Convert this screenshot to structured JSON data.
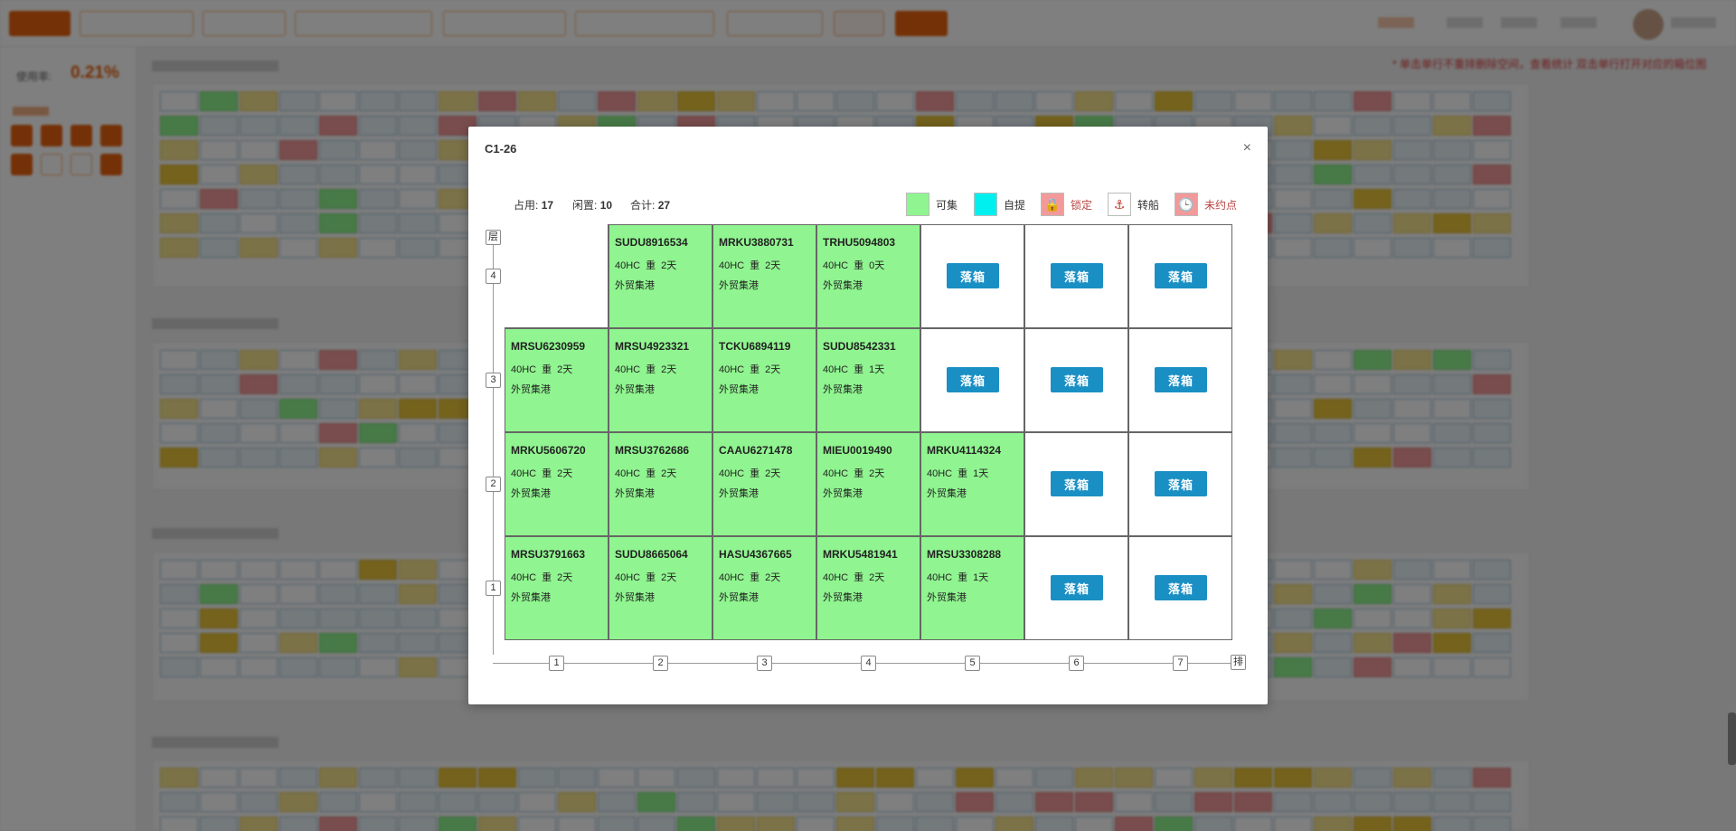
{
  "modal": {
    "title": "C1-26",
    "close": "×",
    "stats": {
      "occupied_label": "占用:",
      "occupied": "17",
      "idle_label": "闲置:",
      "idle": "10",
      "total_label": "合计:",
      "total": "27"
    },
    "legend": [
      {
        "label": "可集",
        "color": "#90f590",
        "icon": ""
      },
      {
        "label": "自提",
        "color": "#00f0f0",
        "icon": ""
      },
      {
        "label": "锁定",
        "color": "#f29a9a",
        "icon": "lock-icon",
        "glyph": "🔒"
      },
      {
        "label": "转船",
        "color": "#ffffff",
        "icon": "anchor-icon",
        "glyph": "⚓"
      },
      {
        "label": "未约点",
        "color": "#f29a9a",
        "icon": "clock-icon",
        "glyph": "🕒"
      }
    ],
    "axis": {
      "tier_label": "层",
      "row_label": "排",
      "tiers": [
        "4",
        "3",
        "2",
        "1"
      ],
      "rows": [
        "1",
        "2",
        "3",
        "4",
        "5",
        "6",
        "7"
      ]
    },
    "drop_label": "落箱",
    "grid": [
      [
        null,
        {
          "code": "SUDU8916534",
          "type": "40HC",
          "weight": "重",
          "days": "2天",
          "yard": "外贸集港"
        },
        {
          "code": "MRKU3880731",
          "type": "40HC",
          "weight": "重",
          "days": "2天",
          "yard": "外贸集港"
        },
        {
          "code": "TRHU5094803",
          "type": "40HC",
          "weight": "重",
          "days": "0天",
          "yard": "外贸集港"
        },
        "drop",
        "drop",
        "drop"
      ],
      [
        {
          "code": "MRSU6230959",
          "type": "40HC",
          "weight": "重",
          "days": "2天",
          "yard": "外贸集港"
        },
        {
          "code": "MRSU4923321",
          "type": "40HC",
          "weight": "重",
          "days": "2天",
          "yard": "外贸集港"
        },
        {
          "code": "TCKU6894119",
          "type": "40HC",
          "weight": "重",
          "days": "2天",
          "yard": "外贸集港"
        },
        {
          "code": "SUDU8542331",
          "type": "40HC",
          "weight": "重",
          "days": "1天",
          "yard": "外贸集港"
        },
        "drop",
        "drop",
        "drop"
      ],
      [
        {
          "code": "MRKU5606720",
          "type": "40HC",
          "weight": "重",
          "days": "2天",
          "yard": "外贸集港"
        },
        {
          "code": "MRSU3762686",
          "type": "40HC",
          "weight": "重",
          "days": "2天",
          "yard": "外贸集港"
        },
        {
          "code": "CAAU6271478",
          "type": "40HC",
          "weight": "重",
          "days": "2天",
          "yard": "外贸集港"
        },
        {
          "code": "MIEU0019490",
          "type": "40HC",
          "weight": "重",
          "days": "2天",
          "yard": "外贸集港"
        },
        {
          "code": "MRKU4114324",
          "type": "40HC",
          "weight": "重",
          "days": "1天",
          "yard": "外贸集港"
        },
        "drop",
        "drop"
      ],
      [
        {
          "code": "MRSU3791663",
          "type": "40HC",
          "weight": "重",
          "days": "2天",
          "yard": "外贸集港"
        },
        {
          "code": "SUDU8665064",
          "type": "40HC",
          "weight": "重",
          "days": "2天",
          "yard": "外贸集港"
        },
        {
          "code": "HASU4367665",
          "type": "40HC",
          "weight": "重",
          "days": "2天",
          "yard": "外贸集港"
        },
        {
          "code": "MRKU5481941",
          "type": "40HC",
          "weight": "重",
          "days": "2天",
          "yard": "外贸集港"
        },
        {
          "code": "MRSU3308288",
          "type": "40HC",
          "weight": "重",
          "days": "1天",
          "yard": "外贸集港"
        },
        "drop",
        "drop"
      ]
    ]
  },
  "background": {
    "utilization_label": "使用率:",
    "utilization_value": "0.21%",
    "notice": "* 单击单行不重排删除空间，查看统计 双击单行打开对应的箱位图",
    "sections": [
      "C1",
      "C2",
      "C3",
      "C4"
    ]
  }
}
